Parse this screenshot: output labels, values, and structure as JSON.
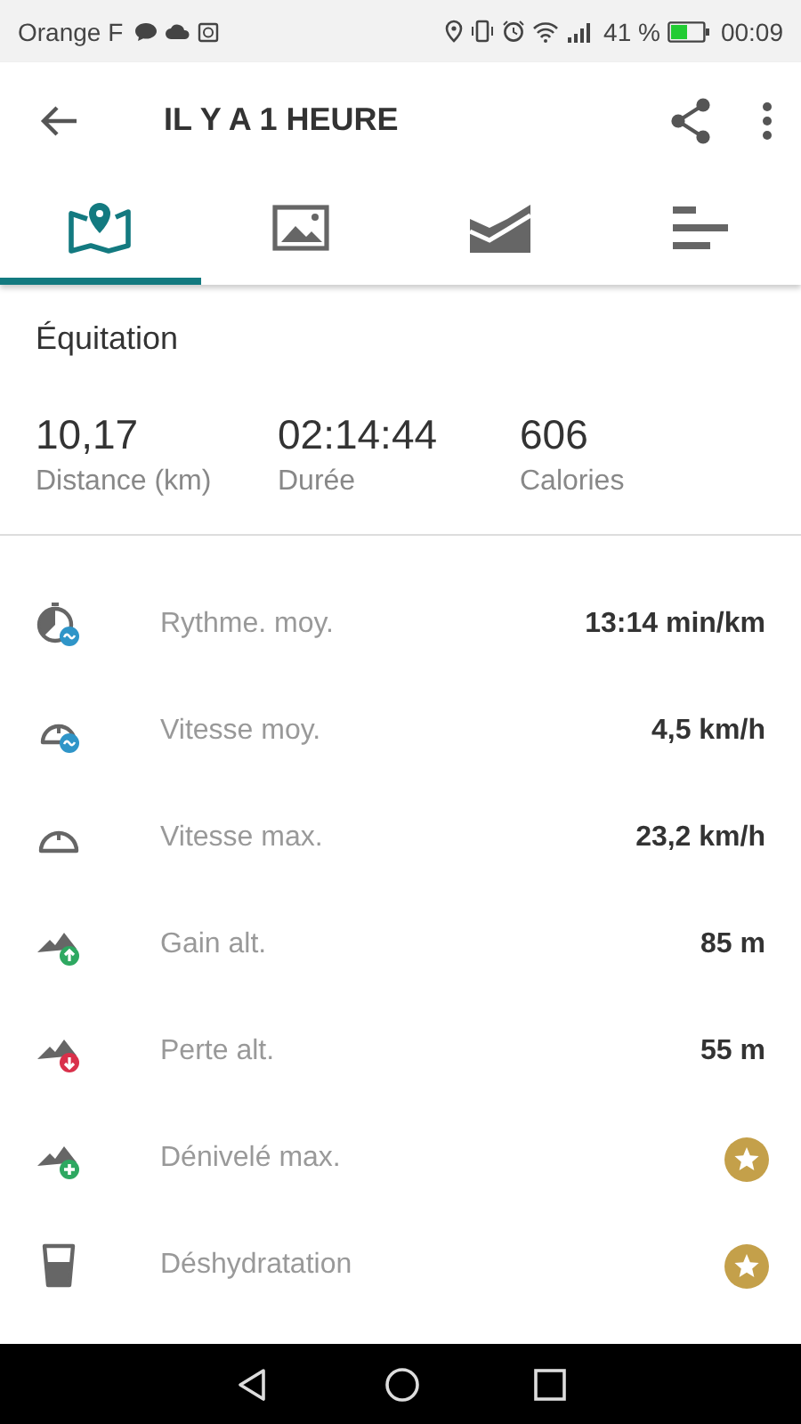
{
  "status_bar": {
    "carrier": "Orange F",
    "battery_percent": "41 %",
    "time": "00:09"
  },
  "toolbar": {
    "title": "IL Y A 1 HEURE"
  },
  "tabs": [
    {
      "kind": "map",
      "selected": true
    },
    {
      "kind": "photos",
      "selected": false
    },
    {
      "kind": "chart",
      "selected": false
    },
    {
      "kind": "list",
      "selected": false
    }
  ],
  "activity": {
    "title": "Équitation"
  },
  "summary": [
    {
      "value": "10,17",
      "label": "Distance (km)"
    },
    {
      "value": "02:14:44",
      "label": "Durée"
    },
    {
      "value": "606",
      "label": "Calories"
    }
  ],
  "metrics": [
    {
      "label": "Rythme. moy.",
      "kind": "value",
      "value": "13:14 min/km"
    },
    {
      "label": "Vitesse moy.",
      "kind": "value",
      "value": "4,5 km/h"
    },
    {
      "label": "Vitesse max.",
      "kind": "value",
      "value": "23,2 km/h"
    },
    {
      "label": "Gain alt.",
      "kind": "value",
      "value": "85 m"
    },
    {
      "label": "Perte alt.",
      "kind": "value",
      "value": "55 m"
    },
    {
      "label": "Dénivelé max.",
      "kind": "premium"
    },
    {
      "label": "Déshydratation",
      "kind": "premium"
    }
  ]
}
